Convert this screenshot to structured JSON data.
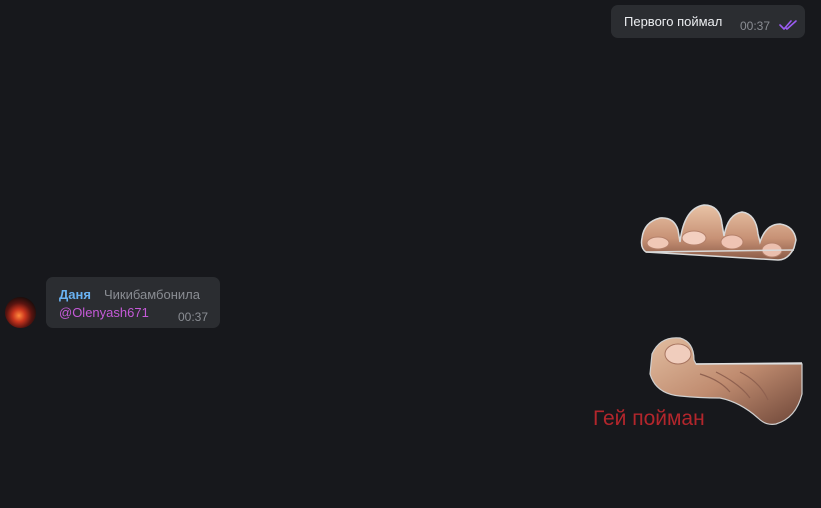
{
  "messages": {
    "outgoing": {
      "text": "Первого поймал",
      "time": "00:37",
      "status_icon": "double-check-icon",
      "check_color": "#9b5cf2"
    },
    "incoming": {
      "sender": "Даня",
      "sender_status": "Чикибамбонила",
      "mention": "@Olenyash671",
      "time": "00:37",
      "sender_color": "#6ab2f2",
      "mention_color": "#c55ad8"
    },
    "stickers": [
      {
        "name": "fingers-sticker"
      },
      {
        "name": "thumb-sticker",
        "caption": "Гей пойман",
        "caption_color": "#b3262c"
      }
    ]
  },
  "theme": {
    "background": "#17181c",
    "bubble": "#2b2d31"
  }
}
